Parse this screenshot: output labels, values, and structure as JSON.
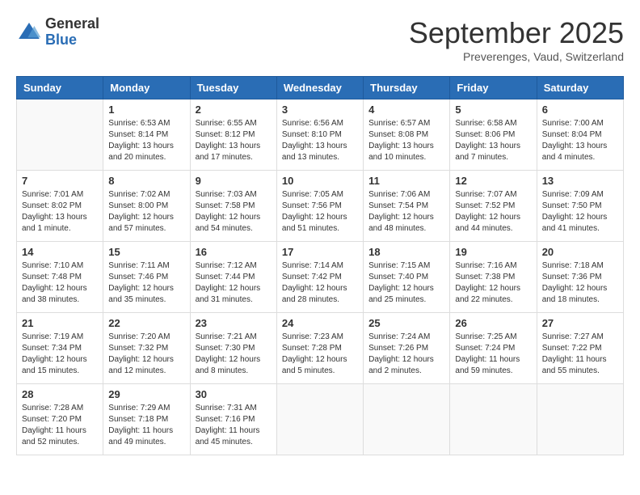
{
  "logo": {
    "general": "General",
    "blue": "Blue"
  },
  "title": "September 2025",
  "location": "Preverenges, Vaud, Switzerland",
  "days_of_week": [
    "Sunday",
    "Monday",
    "Tuesday",
    "Wednesday",
    "Thursday",
    "Friday",
    "Saturday"
  ],
  "weeks": [
    [
      {
        "day": "",
        "info": ""
      },
      {
        "day": "1",
        "info": "Sunrise: 6:53 AM\nSunset: 8:14 PM\nDaylight: 13 hours\nand 20 minutes."
      },
      {
        "day": "2",
        "info": "Sunrise: 6:55 AM\nSunset: 8:12 PM\nDaylight: 13 hours\nand 17 minutes."
      },
      {
        "day": "3",
        "info": "Sunrise: 6:56 AM\nSunset: 8:10 PM\nDaylight: 13 hours\nand 13 minutes."
      },
      {
        "day": "4",
        "info": "Sunrise: 6:57 AM\nSunset: 8:08 PM\nDaylight: 13 hours\nand 10 minutes."
      },
      {
        "day": "5",
        "info": "Sunrise: 6:58 AM\nSunset: 8:06 PM\nDaylight: 13 hours\nand 7 minutes."
      },
      {
        "day": "6",
        "info": "Sunrise: 7:00 AM\nSunset: 8:04 PM\nDaylight: 13 hours\nand 4 minutes."
      }
    ],
    [
      {
        "day": "7",
        "info": "Sunrise: 7:01 AM\nSunset: 8:02 PM\nDaylight: 13 hours\nand 1 minute."
      },
      {
        "day": "8",
        "info": "Sunrise: 7:02 AM\nSunset: 8:00 PM\nDaylight: 12 hours\nand 57 minutes."
      },
      {
        "day": "9",
        "info": "Sunrise: 7:03 AM\nSunset: 7:58 PM\nDaylight: 12 hours\nand 54 minutes."
      },
      {
        "day": "10",
        "info": "Sunrise: 7:05 AM\nSunset: 7:56 PM\nDaylight: 12 hours\nand 51 minutes."
      },
      {
        "day": "11",
        "info": "Sunrise: 7:06 AM\nSunset: 7:54 PM\nDaylight: 12 hours\nand 48 minutes."
      },
      {
        "day": "12",
        "info": "Sunrise: 7:07 AM\nSunset: 7:52 PM\nDaylight: 12 hours\nand 44 minutes."
      },
      {
        "day": "13",
        "info": "Sunrise: 7:09 AM\nSunset: 7:50 PM\nDaylight: 12 hours\nand 41 minutes."
      }
    ],
    [
      {
        "day": "14",
        "info": "Sunrise: 7:10 AM\nSunset: 7:48 PM\nDaylight: 12 hours\nand 38 minutes."
      },
      {
        "day": "15",
        "info": "Sunrise: 7:11 AM\nSunset: 7:46 PM\nDaylight: 12 hours\nand 35 minutes."
      },
      {
        "day": "16",
        "info": "Sunrise: 7:12 AM\nSunset: 7:44 PM\nDaylight: 12 hours\nand 31 minutes."
      },
      {
        "day": "17",
        "info": "Sunrise: 7:14 AM\nSunset: 7:42 PM\nDaylight: 12 hours\nand 28 minutes."
      },
      {
        "day": "18",
        "info": "Sunrise: 7:15 AM\nSunset: 7:40 PM\nDaylight: 12 hours\nand 25 minutes."
      },
      {
        "day": "19",
        "info": "Sunrise: 7:16 AM\nSunset: 7:38 PM\nDaylight: 12 hours\nand 22 minutes."
      },
      {
        "day": "20",
        "info": "Sunrise: 7:18 AM\nSunset: 7:36 PM\nDaylight: 12 hours\nand 18 minutes."
      }
    ],
    [
      {
        "day": "21",
        "info": "Sunrise: 7:19 AM\nSunset: 7:34 PM\nDaylight: 12 hours\nand 15 minutes."
      },
      {
        "day": "22",
        "info": "Sunrise: 7:20 AM\nSunset: 7:32 PM\nDaylight: 12 hours\nand 12 minutes."
      },
      {
        "day": "23",
        "info": "Sunrise: 7:21 AM\nSunset: 7:30 PM\nDaylight: 12 hours\nand 8 minutes."
      },
      {
        "day": "24",
        "info": "Sunrise: 7:23 AM\nSunset: 7:28 PM\nDaylight: 12 hours\nand 5 minutes."
      },
      {
        "day": "25",
        "info": "Sunrise: 7:24 AM\nSunset: 7:26 PM\nDaylight: 12 hours\nand 2 minutes."
      },
      {
        "day": "26",
        "info": "Sunrise: 7:25 AM\nSunset: 7:24 PM\nDaylight: 11 hours\nand 59 minutes."
      },
      {
        "day": "27",
        "info": "Sunrise: 7:27 AM\nSunset: 7:22 PM\nDaylight: 11 hours\nand 55 minutes."
      }
    ],
    [
      {
        "day": "28",
        "info": "Sunrise: 7:28 AM\nSunset: 7:20 PM\nDaylight: 11 hours\nand 52 minutes."
      },
      {
        "day": "29",
        "info": "Sunrise: 7:29 AM\nSunset: 7:18 PM\nDaylight: 11 hours\nand 49 minutes."
      },
      {
        "day": "30",
        "info": "Sunrise: 7:31 AM\nSunset: 7:16 PM\nDaylight: 11 hours\nand 45 minutes."
      },
      {
        "day": "",
        "info": ""
      },
      {
        "day": "",
        "info": ""
      },
      {
        "day": "",
        "info": ""
      },
      {
        "day": "",
        "info": ""
      }
    ]
  ]
}
